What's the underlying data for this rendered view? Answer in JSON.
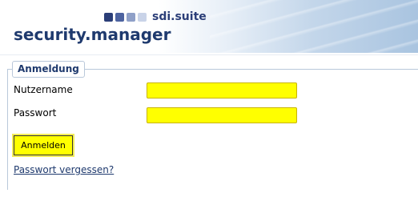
{
  "header": {
    "brand_text": "sdi.suite",
    "app_title": "security.manager",
    "logo_icon": "four-squares-logo-icon"
  },
  "login": {
    "legend": "Anmeldung",
    "username_label": "Nutzername",
    "username_value": "",
    "password_label": "Passwort",
    "password_value": "",
    "submit_label": "Anmelden",
    "forgot_link": "Passwort vergessen?"
  },
  "colors": {
    "field_highlight": "#ffff00",
    "title_color": "#1f3a6e",
    "logo_dark": "#2b3e78"
  }
}
